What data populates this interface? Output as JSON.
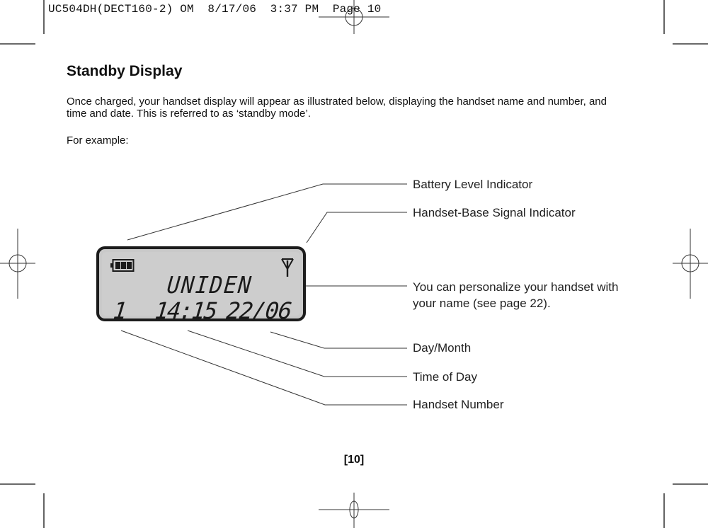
{
  "print_slug": "UC504DH(DECT160-2) OM  8/17/06  3:37 PM  Page 10",
  "heading": "Standby Display",
  "intro": "Once charged, your handset display will appear as illustrated below, displaying the handset name and number, and time and date. This is referred to as ‘standby mode’.",
  "example_label": "For example:",
  "lcd": {
    "handset_name": "UNIDEN",
    "handset_number": "1",
    "time": "14:15",
    "date": "22/06",
    "battery_icon": "battery-full-icon",
    "signal_icon": "antenna-signal-icon"
  },
  "callouts": {
    "battery": "Battery Level Indicator",
    "signal": "Handset-Base Signal Indicator",
    "name": "You can personalize your handset with your name (see page 22).",
    "day_month": "Day/Month",
    "time_of_day": "Time of Day",
    "handset_number": "Handset Number"
  },
  "page_number": "[10]"
}
